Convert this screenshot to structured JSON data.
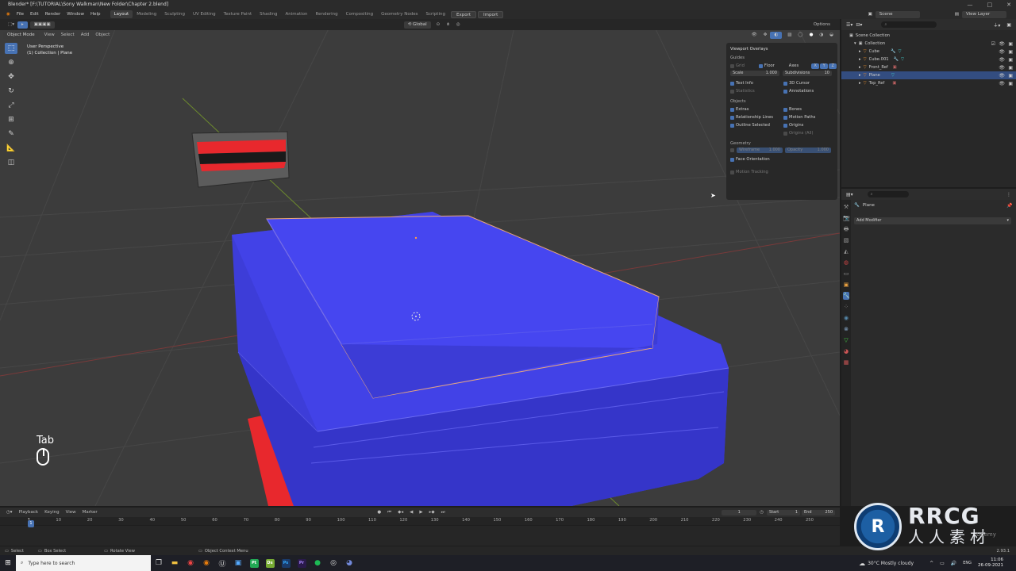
{
  "titlebar": {
    "title": "Blender* [F:\\TUTORIAL\\Sony Walkman\\New Folder\\Chapter 2.blend]"
  },
  "menu": [
    "File",
    "Edit",
    "Render",
    "Window",
    "Help"
  ],
  "workspaces": [
    "Layout",
    "Modeling",
    "Sculpting",
    "UV Editing",
    "Texture Paint",
    "Shading",
    "Animation",
    "Rendering",
    "Compositing",
    "Geometry Nodes",
    "Scripting"
  ],
  "top_buttons": {
    "export": "Export",
    "import": "Import",
    "scene": "Scene",
    "view_layer": "View Layer"
  },
  "viewport_header": {
    "mode": "Object Mode",
    "menus": [
      "View",
      "Select",
      "Add",
      "Object"
    ],
    "transform": "Global",
    "options": "Options"
  },
  "viewport_info": {
    "line1": "User Perspective",
    "line2": "(1) Collection | Plane"
  },
  "key_hint": {
    "key": "Tab"
  },
  "overlays": {
    "title": "Viewport Overlays",
    "guides_label": "Guides",
    "grid": "Grid",
    "floor": "Floor",
    "axes": "Axes",
    "axis_x": "X",
    "axis_y": "Y",
    "axis_z": "Z",
    "scale_label": "Scale",
    "scale_value": "1.000",
    "subdivisions_label": "Subdivisions",
    "subdivisions_value": "10",
    "text_info": "Text Info",
    "cursor_3d": "3D Cursor",
    "statistics": "Statistics",
    "annotations": "Annotations",
    "objects_label": "Objects",
    "extras": "Extras",
    "bones": "Bones",
    "relationship_lines": "Relationship Lines",
    "motion_paths": "Motion Paths",
    "outline_selected": "Outline Selected",
    "origins": "Origins",
    "origins_all": "Origins (All)",
    "geometry_label": "Geometry",
    "wireframe": "Wireframe",
    "wireframe_value": "1.000",
    "opacity": "Opacity",
    "opacity_value": "1.000",
    "face_orientation": "Face Orientation",
    "motion_tracking": "Motion Tracking"
  },
  "outliner": {
    "search_placeholder": "",
    "scene_collection": "Scene Collection",
    "collection": "Collection",
    "items": [
      {
        "name": "Cube",
        "selected": false
      },
      {
        "name": "Cube.001",
        "selected": false
      },
      {
        "name": "Front_Ref",
        "selected": false
      },
      {
        "name": "Plane",
        "selected": true
      },
      {
        "name": "Top_Ref",
        "selected": false
      }
    ]
  },
  "properties": {
    "object": "Plane",
    "add_modifier": "Add Modifier"
  },
  "timeline": {
    "menus": [
      "Playback",
      "Keying",
      "View",
      "Marker"
    ],
    "current_frame": "1",
    "start_label": "Start",
    "start": "1",
    "end_label": "End",
    "end": "250",
    "ticks": [
      "1",
      "10",
      "20",
      "30",
      "40",
      "50",
      "60",
      "70",
      "80",
      "90",
      "100",
      "110",
      "120",
      "130",
      "140",
      "150",
      "160",
      "170",
      "180",
      "190",
      "200",
      "210",
      "220",
      "230",
      "240",
      "250"
    ]
  },
  "statusbar": {
    "select": "Select",
    "box_select": "Box Select",
    "rotate_view": "Rotate View",
    "context_menu": "Object Context Menu",
    "version": "2.93.1"
  },
  "taskbar": {
    "search_placeholder": "Type here to search",
    "weather": "30°C  Mostly cloudy",
    "time": "11:06",
    "date": "26-09-2021",
    "app_labels": {
      "pt": "Pt",
      "ds": "Ds",
      "ps": "Ps",
      "pr": "Pr"
    }
  },
  "watermark": {
    "brand": "RRCG",
    "sub": "人人素材",
    "udemy": "Udemy"
  },
  "colors": {
    "accent": "#4772b3",
    "mesh": "#3b3be6",
    "ref_red": "#e8282d",
    "viewport_bg": "#3c3c3c"
  }
}
